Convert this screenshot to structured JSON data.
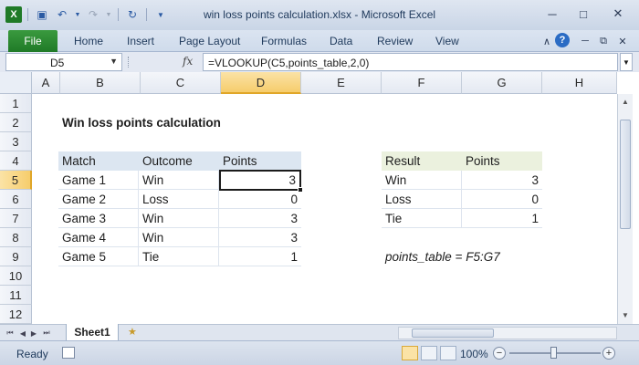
{
  "window": {
    "title": "win loss points calculation.xlsx  -  Microsoft Excel",
    "minimize_icon": "minimize-icon",
    "maximize_icon": "maximize-icon",
    "close_icon": "close-icon"
  },
  "ribbon": {
    "file": "File",
    "tabs": [
      "Home",
      "Insert",
      "Page Layout",
      "Formulas",
      "Data",
      "Review",
      "View"
    ]
  },
  "formula_bar": {
    "name_box": "D5",
    "fx": "fx",
    "formula": "=VLOOKUP(C5,points_table,2,0)"
  },
  "grid": {
    "columns": [
      "A",
      "B",
      "C",
      "D",
      "E",
      "F",
      "G",
      "H"
    ],
    "rows": [
      "1",
      "2",
      "3",
      "4",
      "5",
      "6",
      "7",
      "8",
      "9",
      "10",
      "11",
      "12"
    ],
    "selected_column": "D",
    "selected_row": "5",
    "title": "Win loss points calculation",
    "games_table": {
      "headers": [
        "Match",
        "Outcome",
        "Points"
      ],
      "rows": [
        [
          "Game 1",
          "Win",
          "3"
        ],
        [
          "Game 2",
          "Loss",
          "0"
        ],
        [
          "Game 3",
          "Win",
          "3"
        ],
        [
          "Game 4",
          "Win",
          "3"
        ],
        [
          "Game 5",
          "Tie",
          "1"
        ]
      ]
    },
    "points_table": {
      "headers": [
        "Result",
        "Points"
      ],
      "rows": [
        [
          "Win",
          "3"
        ],
        [
          "Loss",
          "0"
        ],
        [
          "Tie",
          "1"
        ]
      ]
    },
    "note": "points_table = F5:G7"
  },
  "sheets": {
    "active": "Sheet1"
  },
  "status": {
    "ready": "Ready",
    "zoom": "100%",
    "zoom_out": "−",
    "zoom_in": "+"
  },
  "colors": {
    "header_blue": "#dce6f1",
    "header_green": "#ebf1de",
    "file_tab": "#2a8a32",
    "selection_header": "#f6cd6c"
  }
}
